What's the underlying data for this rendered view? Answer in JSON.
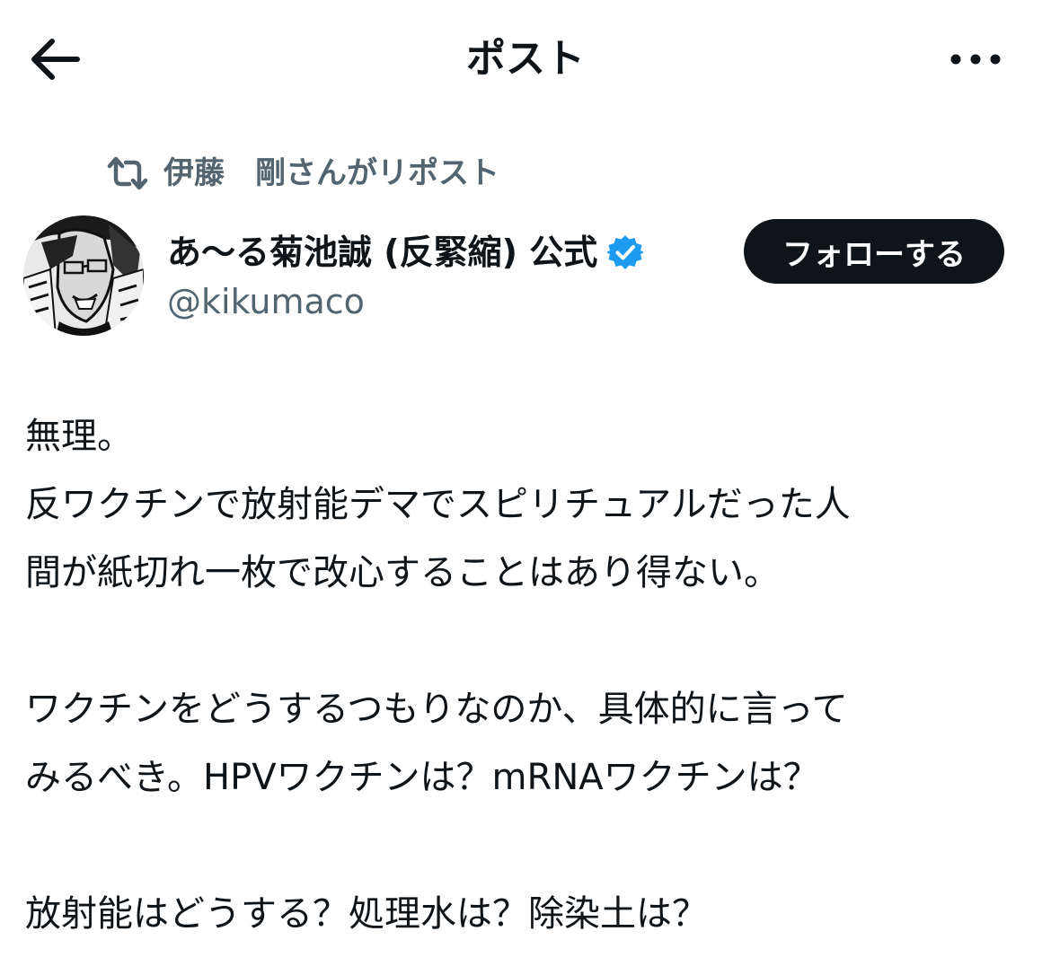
{
  "header": {
    "title": "ポスト",
    "back_icon": "arrow-left-icon",
    "more_icon": "more-horizontal-icon"
  },
  "repost": {
    "icon": "repost-icon",
    "text": "伊藤　剛さんがリポスト"
  },
  "author": {
    "display_name": "あ〜る菊池誠 (反緊縮) 公式",
    "handle": "@kikumaco",
    "verified_icon": "verified-badge-icon",
    "verified_color": "#1d9bf0"
  },
  "follow_button": {
    "label": "フォローする"
  },
  "post": {
    "lines": [
      "無理。",
      "反ワクチンで放射能デマでスピリチュアルだった人",
      "間が紙切れ一枚で改心することはあり得ない。",
      "",
      "ワクチンをどうするつもりなのか、具体的に言って",
      "みるべき。HPVワクチンは？mRNAワクチンは？",
      "",
      "放射能はどうする？処理水は？除染土は？"
    ]
  },
  "colors": {
    "text_primary": "#0f1419",
    "text_secondary": "#536471",
    "button_bg": "#0f1419"
  }
}
